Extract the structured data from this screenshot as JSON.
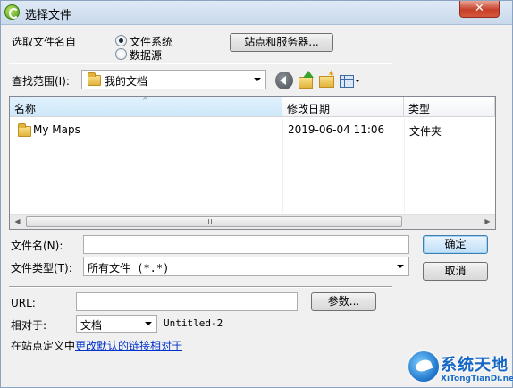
{
  "window": {
    "title": "选择文件",
    "close_glyph": "✕"
  },
  "source": {
    "label": "选取文件名自",
    "options": [
      {
        "label": "文件系统",
        "checked": true
      },
      {
        "label": "数据源",
        "checked": false
      }
    ],
    "sites_button": "站点和服务器..."
  },
  "lookin": {
    "label": "查找范围(I):",
    "value": "我的文档"
  },
  "toolbar": {
    "icons": [
      "back-icon",
      "up-folder-icon",
      "new-folder-icon",
      "view-menu-icon"
    ]
  },
  "list": {
    "columns": [
      "名称",
      "修改日期",
      "类型"
    ],
    "sort_glyph": "^",
    "rows": [
      {
        "name": "My Maps",
        "modified": "2019-06-04 11:06",
        "type": "文件夹"
      }
    ],
    "scroll_left": "◀",
    "scroll_right": "▶"
  },
  "filename": {
    "label": "文件名(N):",
    "value": ""
  },
  "filetype": {
    "label": "文件类型(T):",
    "value": "所有文件 (*.*)"
  },
  "buttons": {
    "ok": "确定",
    "cancel": "取消"
  },
  "url": {
    "label": "URL:",
    "value": "",
    "params_button": "参数..."
  },
  "relative": {
    "label": "相对于:",
    "value": "文档",
    "doc_name": "Untitled-2"
  },
  "site_note": {
    "prefix": "在站点定义中",
    "link": "更改默认的链接相对于"
  },
  "watermark": {
    "title": "系统天地",
    "subtitle": "XiTongTianDi.net"
  }
}
